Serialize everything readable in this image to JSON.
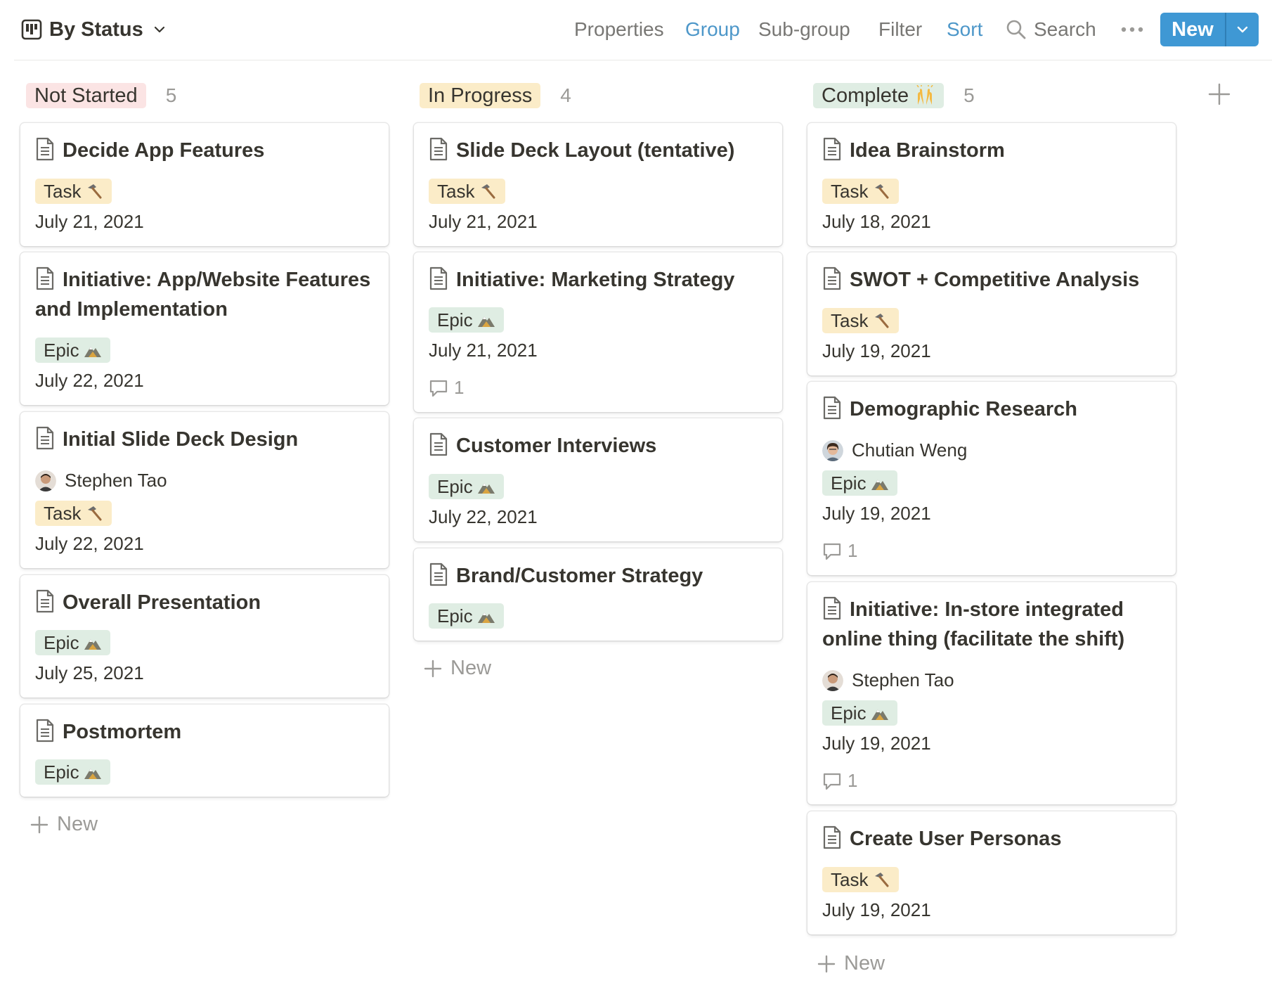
{
  "toolbar": {
    "view_name": "By Status",
    "properties": "Properties",
    "group": "Group",
    "subgroup": "Sub-group",
    "filter": "Filter",
    "sort": "Sort",
    "search": "Search",
    "new_label": "New",
    "accent_color": "#3f98d4",
    "active_color": "#4d97c9"
  },
  "add_new_label": "New",
  "columns": [
    {
      "status": "Not Started",
      "count": "5",
      "pill_bg": "#fbe4e4",
      "cards": [
        {
          "title": "Decide App Features",
          "tag": "Task",
          "date": "July 21, 2021"
        },
        {
          "title": "Initiative: App/Website Features and Implementation",
          "tag": "Epic",
          "date": "July 22, 2021"
        },
        {
          "title": "Initial Slide Deck Design",
          "person": "Stephen Tao",
          "tag": "Task",
          "date": "July 22, 2021"
        },
        {
          "title": "Overall Presentation",
          "tag": "Epic",
          "date": "July 25, 2021"
        },
        {
          "title": "Postmortem",
          "tag": "Epic"
        }
      ]
    },
    {
      "status": "In Progress",
      "count": "4",
      "pill_bg": "#fbecc8",
      "cards": [
        {
          "title": "Slide Deck Layout (tentative)",
          "tag": "Task",
          "date": "July 21, 2021"
        },
        {
          "title": "Initiative: Marketing Strategy",
          "tag": "Epic",
          "date": "July 21, 2021",
          "comments": "1"
        },
        {
          "title": "Customer Interviews",
          "tag": "Epic",
          "date": "July 22, 2021"
        },
        {
          "title": "Brand/Customer Strategy",
          "tag": "Epic"
        }
      ]
    },
    {
      "status": "Complete",
      "status_emoji": "raising-hands-icon",
      "count": "5",
      "pill_bg": "#dfede3",
      "cards": [
        {
          "title": "Idea Brainstorm",
          "tag": "Task",
          "date": "July 18, 2021"
        },
        {
          "title": "SWOT + Competitive Analysis",
          "tag": "Task",
          "date": "July 19, 2021"
        },
        {
          "title": "Demographic Research",
          "person": "Chutian Weng",
          "tag": "Epic",
          "date": "July 19, 2021",
          "comments": "1"
        },
        {
          "title": "Initiative: In-store integrated online thing (facilitate the shift)",
          "person": "Stephen Tao",
          "tag": "Epic",
          "date": "July 19, 2021",
          "comments": "1"
        },
        {
          "title": "Create User Personas",
          "tag": "Task",
          "date": "July 19, 2021"
        }
      ]
    }
  ]
}
